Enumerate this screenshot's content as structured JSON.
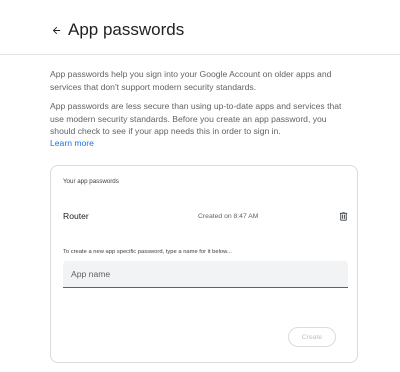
{
  "header": {
    "title": "App passwords",
    "back_icon": "arrow-back-icon"
  },
  "intro": {
    "paragraph1": "App passwords help you sign into your Google Account on older apps and services that don't support modern security standards.",
    "paragraph2": "App passwords are less secure than using up-to-date apps and services that use modern security standards. Before you create an app password, you should check to see if your app needs this in order to sign in.",
    "learn_more": "Learn more"
  },
  "card": {
    "heading": "Your app passwords",
    "passwords": [
      {
        "name": "Router",
        "created": "Created on 8:47 AM",
        "delete_icon": "trash-icon"
      }
    ],
    "instruction": "To create a new app specific password, type a name for it below...",
    "input": {
      "placeholder": "App name",
      "value": ""
    },
    "create_label": "Create"
  },
  "colors": {
    "link": "#1a73e8",
    "text_secondary": "#5f6368",
    "input_bg": "#f1f3f4",
    "border": "#dadce0"
  }
}
